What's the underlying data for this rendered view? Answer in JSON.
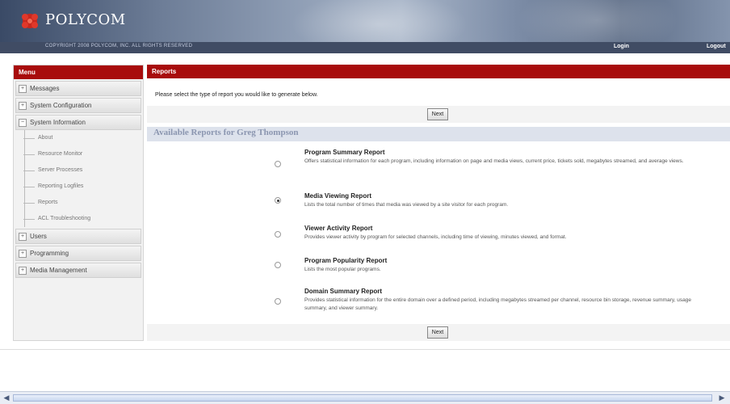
{
  "header": {
    "brand": "POLYCOM",
    "copyright": "COPYRIGHT 2008 POLYCOM, INC. ALL RIGHTS RESERVED",
    "links": [
      "Login",
      "Logout"
    ]
  },
  "menu": {
    "title": "Menu",
    "items": [
      {
        "label": "Messages",
        "toggle": "+"
      },
      {
        "label": "System Configuration",
        "toggle": "+"
      },
      {
        "label": "System Information",
        "toggle": "−"
      }
    ],
    "subitems": [
      "About",
      "Resource Monitor",
      "Server Processes",
      "Reporting Logfiles",
      "Reports",
      "ACL Troubleshooting"
    ],
    "items_after": [
      {
        "label": "Users",
        "toggle": "+"
      },
      {
        "label": "Programming",
        "toggle": "+"
      },
      {
        "label": "Media Management",
        "toggle": "+"
      }
    ]
  },
  "content": {
    "title": "Reports",
    "instruction": "Please select the type of report you would like to generate below.",
    "next_label": "Next",
    "available_heading": "Available Reports for Greg Thompson",
    "reports": [
      {
        "title": "Program Summary Report",
        "description": "Offers statistical information for each program, including information on page and media views, current price, tickets sold, megabytes streamed, and average views.",
        "selected": false
      },
      {
        "title": "Media Viewing Report",
        "description": "Lists the total number of times that media was viewed by a site visitor for each program.",
        "selected": true
      },
      {
        "title": "Viewer Activity Report",
        "description": "Provides viewer activity by program for selected channels, including time of viewing, minutes viewed, and format.",
        "selected": false
      },
      {
        "title": "Program Popularity Report",
        "description": "Lists the most popular programs.",
        "selected": false
      },
      {
        "title": "Domain Summary Report",
        "description": "Provides statistical information for the entire domain over a defined period, including megabytes streamed per channel, resource bin storage, revenue summary, usage summary, and viewer summary.",
        "selected": false
      }
    ]
  },
  "colors": {
    "accent": "#a80c0c",
    "header": "#404c64"
  }
}
